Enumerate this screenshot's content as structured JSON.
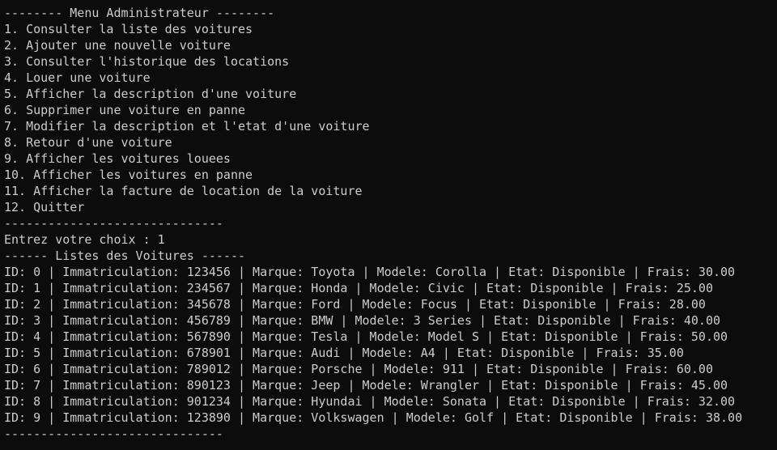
{
  "colors": {
    "background": "#0c0c0c",
    "text": "#cccccc"
  },
  "menu": {
    "header": "-------- Menu Administrateur --------",
    "items": [
      "1. Consulter la liste des voitures",
      "2. Ajouter une nouvelle voiture",
      "3. Consulter l'historique des locations",
      "4. Louer une voiture",
      "5. Afficher la description d'une voiture",
      "6. Supprimer une voiture en panne",
      "7. Modifier la description et l'etat d'une voiture",
      "8. Retour d'une voiture",
      "9. Afficher les voitures louees",
      "10. Afficher les voitures en panne",
      "11. Afficher la facture de location de la voiture",
      "12. Quitter"
    ],
    "footer": "------------------------------"
  },
  "prompt": {
    "text": "Entrez votre choix : 1"
  },
  "car_list": {
    "header": "------ Listes des Voitures ------",
    "rows": [
      "ID: 0 | Immatriculation: 123456 | Marque: Toyota | Modele: Corolla | Etat: Disponible | Frais: 30.00",
      "ID: 1 | Immatriculation: 234567 | Marque: Honda | Modele: Civic | Etat: Disponible | Frais: 25.00",
      "ID: 2 | Immatriculation: 345678 | Marque: Ford | Modele: Focus | Etat: Disponible | Frais: 28.00",
      "ID: 3 | Immatriculation: 456789 | Marque: BMW | Modele: 3 Series | Etat: Disponible | Frais: 40.00",
      "ID: 4 | Immatriculation: 567890 | Marque: Tesla | Modele: Model S | Etat: Disponible | Frais: 50.00",
      "ID: 5 | Immatriculation: 678901 | Marque: Audi | Modele: A4 | Etat: Disponible | Frais: 35.00",
      "ID: 6 | Immatriculation: 789012 | Marque: Porsche | Modele: 911 | Etat: Disponible | Frais: 60.00",
      "ID: 7 | Immatriculation: 890123 | Marque: Jeep | Modele: Wrangler | Etat: Disponible | Frais: 45.00",
      "ID: 8 | Immatriculation: 901234 | Marque: Hyundai | Modele: Sonata | Etat: Disponible | Frais: 32.00",
      "ID: 9 | Immatriculation: 123890 | Marque: Volkswagen | Modele: Golf | Etat: Disponible | Frais: 38.00"
    ],
    "footer": "------------------------------"
  }
}
